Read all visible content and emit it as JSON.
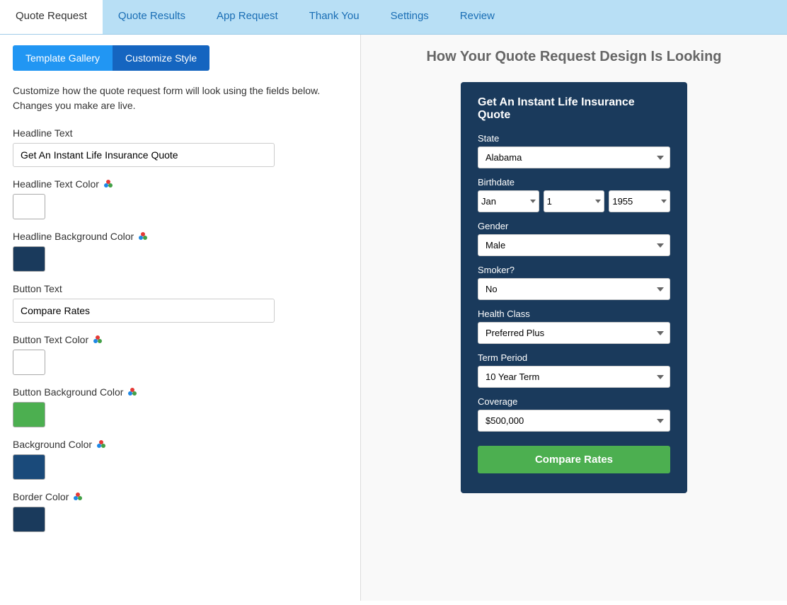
{
  "nav": {
    "tabs": [
      {
        "label": "Quote Request",
        "active": true
      },
      {
        "label": "Quote Results",
        "active": false
      },
      {
        "label": "App Request",
        "active": false
      },
      {
        "label": "Thank You",
        "active": false
      },
      {
        "label": "Settings",
        "active": false
      },
      {
        "label": "Review",
        "active": false
      }
    ]
  },
  "buttons": {
    "template_gallery": "Template Gallery",
    "customize_style": "Customize Style"
  },
  "description": "Customize how the quote request form will look using the fields below. Changes you make are live.",
  "fields": {
    "headline_text_label": "Headline Text",
    "headline_text_value": "Get An Instant Life Insurance Quote",
    "headline_text_color_label": "Headline Text Color",
    "headline_bg_color_label": "Headline Background Color",
    "button_text_label": "Button Text",
    "button_text_value": "Compare Rates",
    "button_text_color_label": "Button Text Color",
    "button_bg_color_label": "Button Background Color",
    "background_color_label": "Background Color",
    "border_color_label": "Border Color"
  },
  "preview": {
    "title": "How Your Quote Request Design Is Looking",
    "form": {
      "headline": "Get An Instant Life Insurance Quote",
      "state_label": "State",
      "state_value": "Alabama",
      "birthdate_label": "Birthdate",
      "birthdate_month": "Jan",
      "birthdate_day": "1",
      "birthdate_year": "1955",
      "gender_label": "Gender",
      "gender_value": "Male",
      "smoker_label": "Smoker?",
      "smoker_value": "No",
      "health_class_label": "Health Class",
      "health_class_value": "Preferred Plus",
      "term_period_label": "Term Period",
      "term_period_value": "10 Year Term",
      "coverage_label": "Coverage",
      "coverage_value": "$500,000",
      "button_label": "Compare Rates"
    }
  }
}
